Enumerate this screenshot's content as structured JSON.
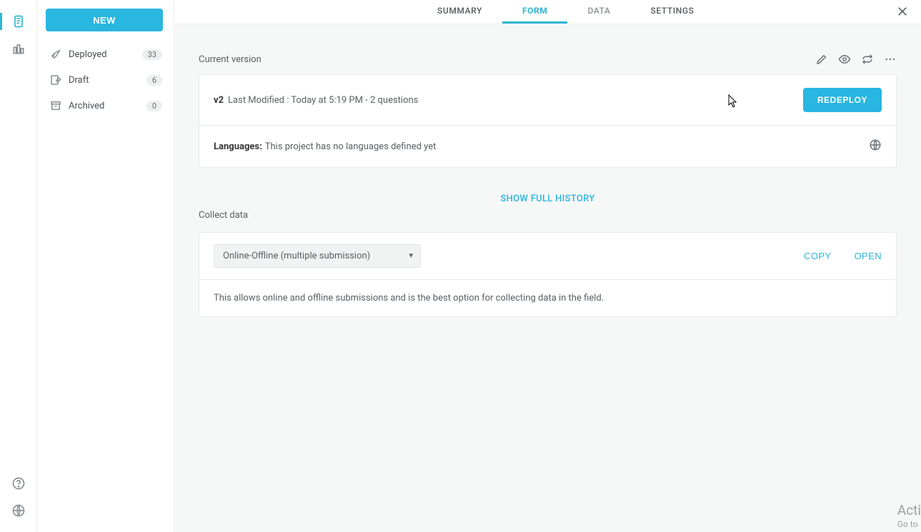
{
  "sidebar": {
    "new_label": "NEW",
    "items": [
      {
        "label": "Deployed",
        "count": "33"
      },
      {
        "label": "Draft",
        "count": "6"
      },
      {
        "label": "Archived",
        "count": "0"
      }
    ]
  },
  "tabs": {
    "summary": "SUMMARY",
    "form": "FORM",
    "data": "DATA",
    "settings": "SETTINGS"
  },
  "current_version": {
    "title": "Current version",
    "version_tag": "v2",
    "version_text": "Last Modified : Today at 5:19 PM - 2 questions",
    "redeploy_label": "REDEPLOY",
    "languages_label": "Languages:",
    "languages_text": "This project has no languages defined yet"
  },
  "show_history": "SHOW FULL HISTORY",
  "collect": {
    "title": "Collect data",
    "select_value": "Online-Offline (multiple submission)",
    "copy_label": "COPY",
    "open_label": "OPEN",
    "description": "This allows online and offline submissions and is the best option for collecting data in the field."
  },
  "watermark": {
    "line1": "Acti",
    "line2": "Go to"
  }
}
